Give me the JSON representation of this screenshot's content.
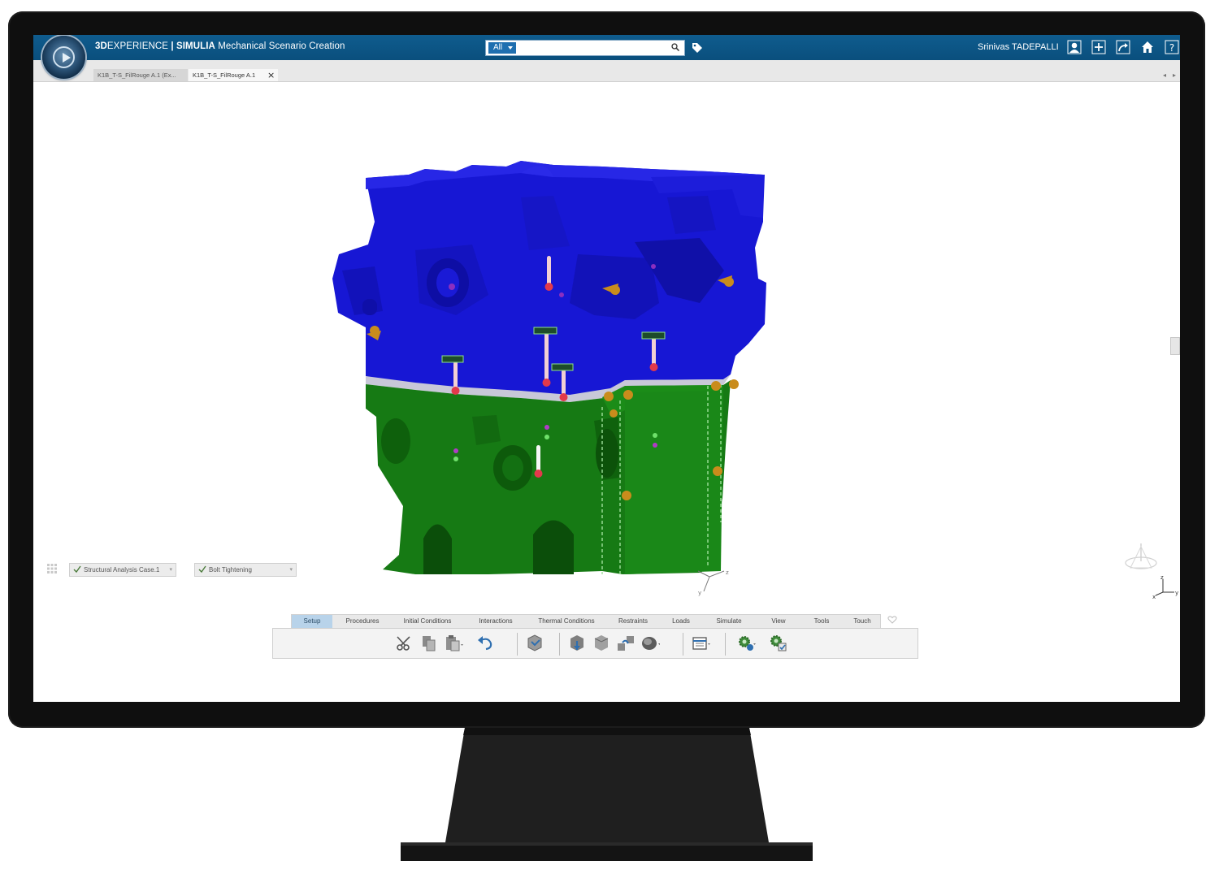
{
  "topbar": {
    "brand_3d": "3D",
    "brand_experience": "EXPERIENCE",
    "brand_divider": " | ",
    "brand_simulia": "SIMULIA",
    "app_name": " Mechanical Scenario Creation",
    "search_scope": "All",
    "user_name": "Srinivas TADEPALLI",
    "icons": [
      "user-icon",
      "add-icon",
      "share-icon",
      "home-icon",
      "help-icon"
    ]
  },
  "tabs": [
    {
      "label": "K1B_T-S_FilRouge A.1 (Ex...",
      "active": false
    },
    {
      "label": "K1B_T-S_FilRouge A.1",
      "active": true
    }
  ],
  "tab_close": "×",
  "breadcrumbs": [
    {
      "label": "Structural Analysis Case.1"
    },
    {
      "label": "Bolt Tightening"
    }
  ],
  "action_bar": {
    "tabs": [
      "Setup",
      "Procedures",
      "Initial Conditions",
      "Interactions",
      "Thermal Conditions",
      "Restraints",
      "Loads",
      "Simulate",
      "View",
      "Tools",
      "Touch"
    ],
    "selected_tab": "Setup",
    "tools": [
      "cut-icon",
      "copy-icon",
      "paste-icon",
      "undo-icon",
      "update-icon",
      "assembly-icon",
      "part-icon",
      "connection-icon",
      "mesh-icon",
      "display-icon",
      "simulation-settings-icon",
      "simulation-run-icon"
    ]
  },
  "colors": {
    "topbar": "#0a4f7d",
    "upper_body": "#1a1ad6",
    "lower_body": "#157a14",
    "accent": "#b8d3ea"
  }
}
